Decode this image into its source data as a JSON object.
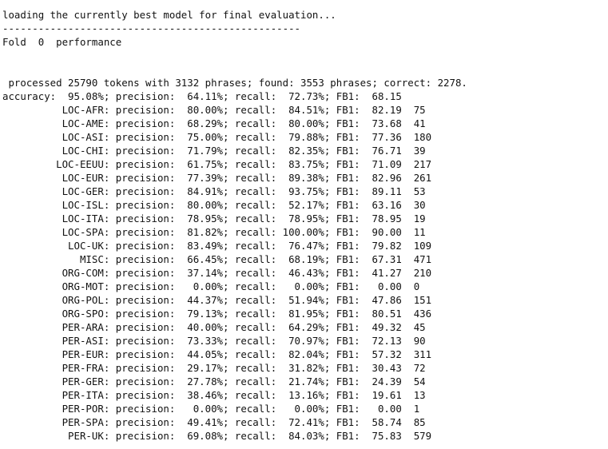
{
  "colors": {
    "background": "#ffffff",
    "text": "#111111"
  },
  "lines": [
    "loading the currently best model for final evaluation...",
    "--------------------------------------------------",
    "Fold  0  performance",
    "",
    "",
    " processed 25790 tokens with 3132 phrases; found: 3553 phrases; correct: 2278.",
    "accuracy:  95.08%; precision:  64.11%; recall:  72.73%; FB1:  68.15",
    "          LOC-AFR: precision:  80.00%; recall:  84.51%; FB1:  82.19  75",
    "          LOC-AME: precision:  68.29%; recall:  80.00%; FB1:  73.68  41",
    "          LOC-ASI: precision:  75.00%; recall:  79.88%; FB1:  77.36  180",
    "          LOC-CHI: precision:  71.79%; recall:  82.35%; FB1:  76.71  39",
    "         LOC-EEUU: precision:  61.75%; recall:  83.75%; FB1:  71.09  217",
    "          LOC-EUR: precision:  77.39%; recall:  89.38%; FB1:  82.96  261",
    "          LOC-GER: precision:  84.91%; recall:  93.75%; FB1:  89.11  53",
    "          LOC-ISL: precision:  80.00%; recall:  52.17%; FB1:  63.16  30",
    "          LOC-ITA: precision:  78.95%; recall:  78.95%; FB1:  78.95  19",
    "          LOC-SPA: precision:  81.82%; recall: 100.00%; FB1:  90.00  11",
    "           LOC-UK: precision:  83.49%; recall:  76.47%; FB1:  79.82  109",
    "             MISC: precision:  66.45%; recall:  68.19%; FB1:  67.31  471",
    "          ORG-COM: precision:  37.14%; recall:  46.43%; FB1:  41.27  210",
    "          ORG-MOT: precision:   0.00%; recall:   0.00%; FB1:   0.00  0",
    "          ORG-POL: precision:  44.37%; recall:  51.94%; FB1:  47.86  151",
    "          ORG-SPO: precision:  79.13%; recall:  81.95%; FB1:  80.51  436",
    "          PER-ARA: precision:  40.00%; recall:  64.29%; FB1:  49.32  45",
    "          PER-ASI: precision:  73.33%; recall:  70.97%; FB1:  72.13  90",
    "          PER-EUR: precision:  44.05%; recall:  82.04%; FB1:  57.32  311",
    "          PER-FRA: precision:  29.17%; recall:  31.82%; FB1:  30.43  72",
    "          PER-GER: precision:  27.78%; recall:  21.74%; FB1:  24.39  54",
    "          PER-ITA: precision:  38.46%; recall:  13.16%; FB1:  19.61  13",
    "          PER-POR: precision:   0.00%; recall:   0.00%; FB1:   0.00  1",
    "          PER-SPA: precision:  49.41%; recall:  72.41%; FB1:  58.74  85",
    "           PER-UK: precision:  69.08%; recall:  84.03%; FB1:  75.83  579"
  ]
}
